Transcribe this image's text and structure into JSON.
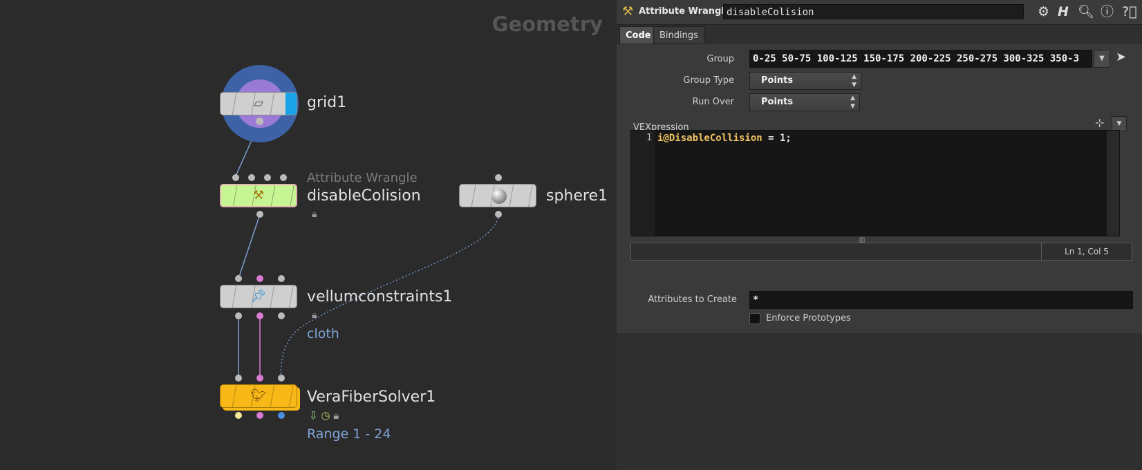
{
  "network": {
    "context_title": "Geometry",
    "nodes": {
      "grid": {
        "name": "grid1"
      },
      "wrangle": {
        "type_label": "Attribute Wrangle",
        "name": "disableColision"
      },
      "sphere": {
        "name": "sphere1"
      },
      "vellum": {
        "name": "vellumconstraints1",
        "output_label": "cloth"
      },
      "solver": {
        "name": "VeraFiberSolver1",
        "range_label": "Range 1 - 24"
      }
    }
  },
  "panel": {
    "node_type": "Attribute Wrangle",
    "node_name": "disableColision",
    "tabs": [
      "Code",
      "Bindings"
    ],
    "active_tab": "Code",
    "params": {
      "group_label": "Group",
      "group_value": "0-25 50-75 100-125 150-175 200-225 250-275 300-325 350-3",
      "group_type_label": "Group Type",
      "group_type_value": "Points",
      "run_over_label": "Run Over",
      "run_over_value": "Points",
      "vexpression_label": "VEXpression",
      "line_number": "1",
      "code_line": "i@DisableCollision = 1;",
      "cursor_status": "Ln 1, Col 5",
      "attributes_label": "Attributes to Create",
      "attributes_value": "*",
      "enforce_label": "Enforce Prototypes"
    }
  },
  "colors": {
    "wrangle_node": "#c8f593",
    "solver_node": "#f8b817",
    "grid_outer": "#3d63a6",
    "grid_inner": "#9a7ad6",
    "wire_blue": "#7aa0cf",
    "wire_pink": "#d97ad3",
    "code_attr": "#f0c463"
  }
}
